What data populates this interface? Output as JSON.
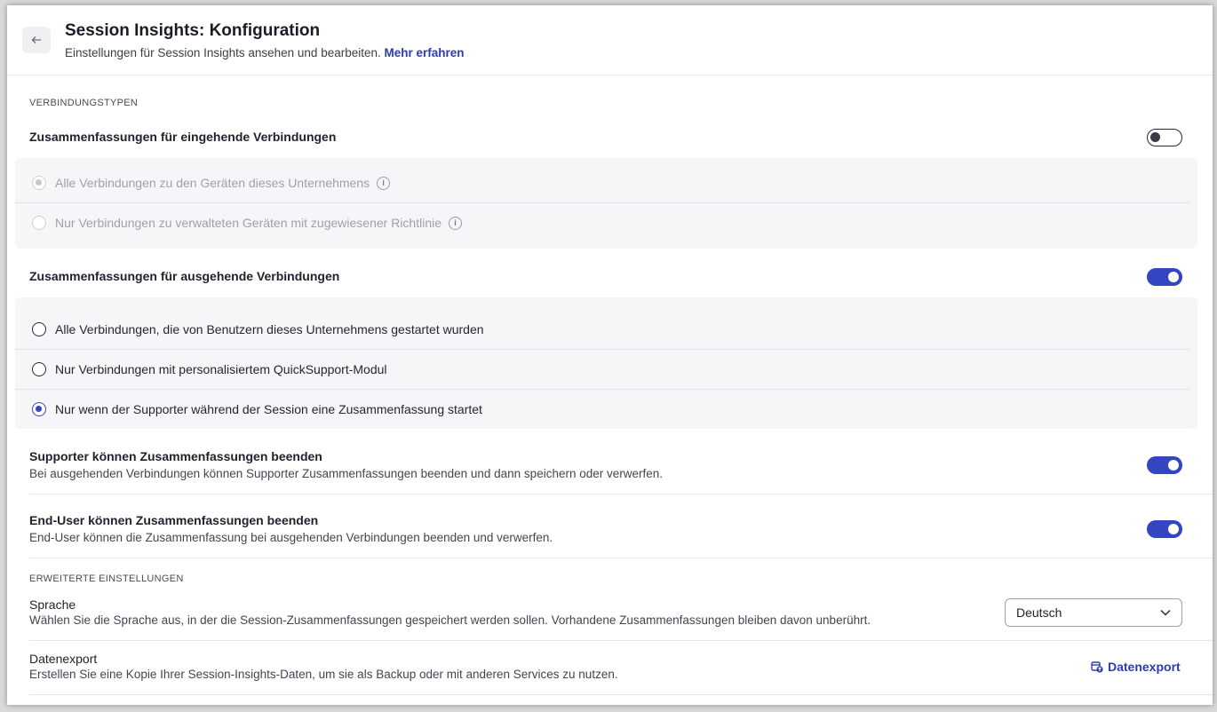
{
  "header": {
    "back_icon": "arrow-left-icon",
    "title": "Session Insights: Konfiguration",
    "subtitle": "Einstellungen für Session Insights ansehen und bearbeiten.",
    "learn_more": "Mehr erfahren"
  },
  "connection_types": {
    "section_label": "VERBINDUNGSTYPEN",
    "incoming": {
      "title": "Zusammenfassungen für eingehende Verbindungen",
      "enabled": false,
      "options": [
        {
          "label": "Alle Verbindungen zu den Geräten dieses Unternehmens",
          "selected": true,
          "disabled": true
        },
        {
          "label": "Nur Verbindungen zu verwalteten Geräten mit zugewiesener Richtlinie",
          "selected": false,
          "disabled": true
        }
      ]
    },
    "outgoing": {
      "title": "Zusammenfassungen für ausgehende Verbindungen",
      "enabled": true,
      "options": [
        {
          "label": "Alle Verbindungen, die von Benutzern dieses Unternehmens gestartet wurden",
          "selected": false
        },
        {
          "label": "Nur Verbindungen mit personalisiertem QuickSupport-Modul",
          "selected": false
        },
        {
          "label": "Nur wenn der Supporter während der Session eine Zusammenfassung startet",
          "selected": true
        }
      ]
    },
    "supporter_end": {
      "title": "Supporter können Zusammenfassungen beenden",
      "description": "Bei ausgehenden Verbindungen können Supporter Zusammenfassungen beenden und dann speichern oder verwerfen.",
      "enabled": true
    },
    "enduser_end": {
      "title": "End-User können Zusammenfassungen beenden",
      "description": "End-User können die Zusammenfassung bei ausgehenden Verbindungen beenden und verwerfen.",
      "enabled": true
    }
  },
  "advanced": {
    "section_label": "ERWEITERTE EINSTELLUNGEN",
    "language": {
      "title": "Sprache",
      "description": "Wählen Sie die Sprache aus, in der die Session-Zusammenfassungen gespeichert werden sollen. Vorhandene Zusammenfassungen bleiben davon unberührt.",
      "selected": "Deutsch"
    },
    "export": {
      "title": "Datenexport",
      "description": "Erstellen Sie eine Kopie Ihrer Session-Insights-Daten, um sie als Backup oder mit anderen Services zu nutzen.",
      "button_label": "Datenexport"
    }
  },
  "colors": {
    "accent": "#3445c2",
    "link": "#2f3bb0"
  }
}
